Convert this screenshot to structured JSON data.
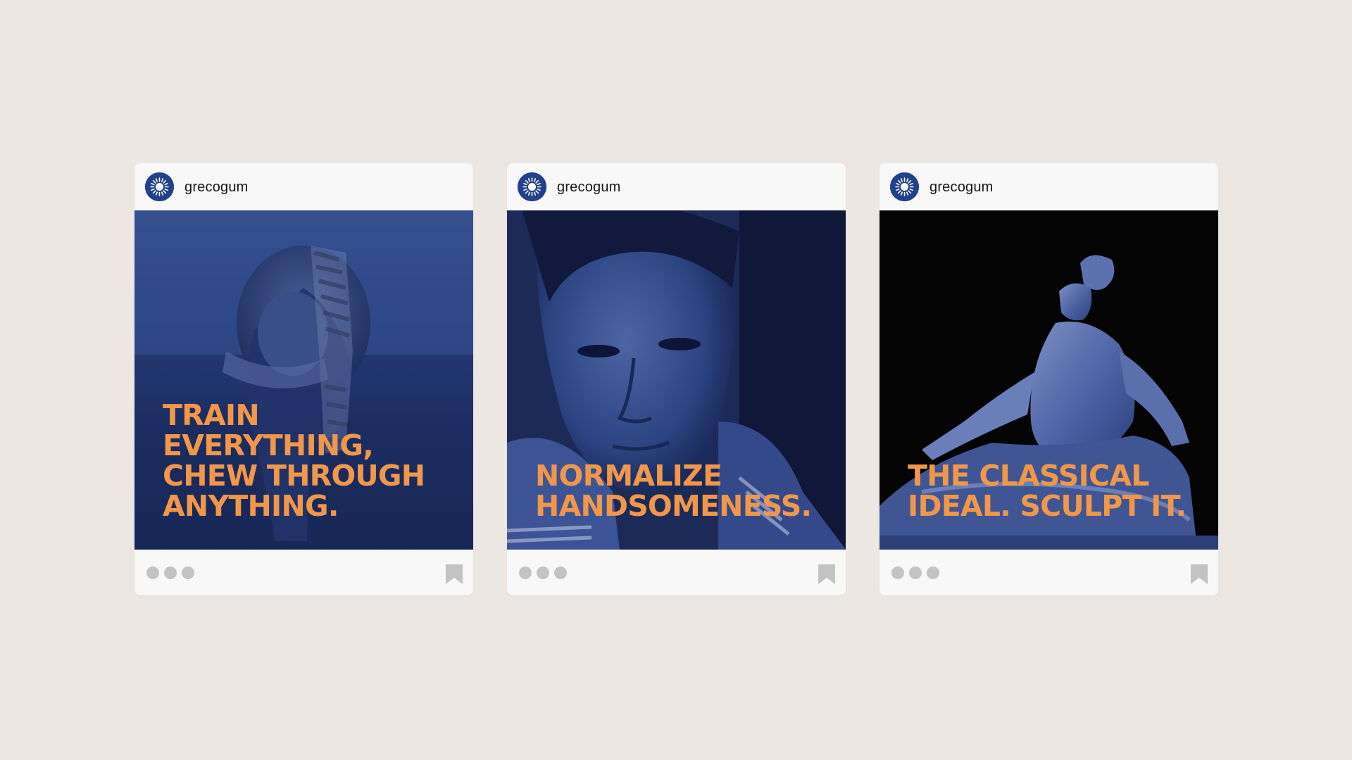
{
  "posts": [
    {
      "account": {
        "username": "grecogum",
        "avatar_icon": "sunburst-logo-icon"
      },
      "headline": "TRAIN\nEVERYTHING,\nCHEW THROUGH\nANYTHING.",
      "image_subject": "lion carrying zebra",
      "footer": {
        "more_icon": "more-dots-icon",
        "save_icon": "bookmark-icon"
      }
    },
    {
      "account": {
        "username": "grecogum",
        "avatar_icon": "sunburst-logo-icon"
      },
      "headline": "NORMALIZE\nHANDSOMENESS.",
      "image_subject": "portrait of a man",
      "footer": {
        "more_icon": "more-dots-icon",
        "save_icon": "bookmark-icon"
      }
    },
    {
      "account": {
        "username": "grecogum",
        "avatar_icon": "sunburst-logo-icon"
      },
      "headline": "THE CLASSICAL\nIDEAL. SCULPT IT.",
      "image_subject": "classical marble statue",
      "footer": {
        "more_icon": "more-dots-icon",
        "save_icon": "bookmark-icon"
      }
    }
  ],
  "colors": {
    "background": "#ece7e2",
    "card": "#f8f8f8",
    "brand_blue": "#21418a",
    "duotone_blue": "#2a3f7c",
    "headline_orange": "#f0974a",
    "footer_icons": "#c3c3c3"
  }
}
